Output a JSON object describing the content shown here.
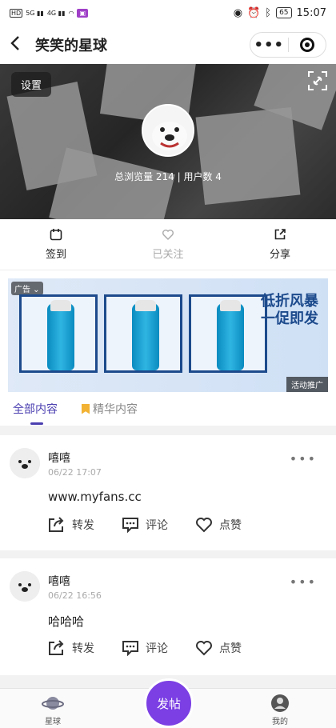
{
  "status": {
    "signal_left": "HD 5G 4G",
    "battery": "65",
    "time": "15:07"
  },
  "nav": {
    "title": "笑笑的星球",
    "more": "•••"
  },
  "banner": {
    "settings_label": "设置",
    "stats_text": "总浏览量 214 | 用户数 4"
  },
  "actions": [
    {
      "label": "签到",
      "icon": "calendar-icon"
    },
    {
      "label": "已关注",
      "icon": "heart-icon"
    },
    {
      "label": "分享",
      "icon": "share-icon"
    }
  ],
  "ad": {
    "tag": "广告",
    "slogan": "低折风暴 一促即发",
    "corner": "活动推广"
  },
  "tabs": [
    {
      "label": "全部内容",
      "active": true
    },
    {
      "label": "精华内容",
      "active": false
    }
  ],
  "posts": [
    {
      "author": "嘻嘻",
      "time": "06/22 17:07",
      "content": "www.myfans.cc",
      "repost": "转发",
      "comment": "评论",
      "like": "点赞"
    },
    {
      "author": "嘻嘻",
      "time": "06/22 16:56",
      "content": "哈哈哈",
      "repost": "转发",
      "comment": "评论",
      "like": "点赞"
    }
  ],
  "bottom_nav": {
    "planet": "星球",
    "post": "发帖",
    "mine": "我的"
  },
  "colors": {
    "accent": "#4b3fb0",
    "fab": "#7b3fe4",
    "bookmark": "#f2b233"
  }
}
